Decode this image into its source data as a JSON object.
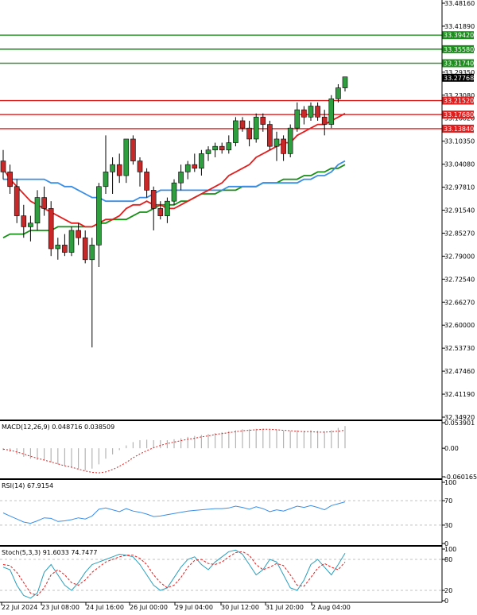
{
  "chart_data": {
    "type": "candlestick",
    "main": {
      "ylim": [
        32.3492,
        33.4816
      ],
      "y_ticks": [
        "33.48160",
        "33.41890",
        "33.35580",
        "33.29350",
        "33.23080",
        "33.16820",
        "33.10350",
        "33.04080",
        "32.97810",
        "32.91540",
        "32.85270",
        "32.79000",
        "32.72540",
        "32.66270",
        "32.60000",
        "32.53730",
        "32.47460",
        "32.41190",
        "32.34920"
      ],
      "current_price": {
        "label": "33.27768",
        "value": 33.27768
      },
      "levels": [
        {
          "label": "33.39420",
          "value": 33.3942,
          "color": "#1e8c1e"
        },
        {
          "label": "33.35580",
          "value": 33.3558,
          "color": "#1e8c1e"
        },
        {
          "label": "33.31740",
          "value": 33.3174,
          "color": "#1e8c1e"
        },
        {
          "label": "33.21520",
          "value": 33.2152,
          "color": "#dd1f1f"
        },
        {
          "label": "33.17680",
          "value": 33.1768,
          "color": "#dd1f1f"
        },
        {
          "label": "33.13840",
          "value": 33.1384,
          "color": "#dd1f1f"
        }
      ],
      "candles": [
        [
          33.05,
          33.08,
          33.0,
          33.02
        ],
        [
          33.02,
          33.04,
          32.96,
          32.98
        ],
        [
          32.98,
          33.0,
          32.88,
          32.9
        ],
        [
          32.9,
          32.93,
          32.84,
          32.87
        ],
        [
          32.87,
          32.9,
          32.83,
          32.88
        ],
        [
          32.88,
          32.97,
          32.86,
          32.95
        ],
        [
          32.95,
          32.98,
          32.9,
          32.92
        ],
        [
          32.92,
          32.94,
          32.79,
          32.81
        ],
        [
          32.81,
          32.84,
          32.78,
          32.82
        ],
        [
          32.82,
          32.85,
          32.79,
          32.8
        ],
        [
          32.8,
          32.87,
          32.79,
          32.86
        ],
        [
          32.86,
          32.88,
          32.82,
          32.84
        ],
        [
          32.84,
          32.86,
          32.77,
          32.78
        ],
        [
          32.78,
          32.84,
          32.54,
          32.82
        ],
        [
          32.82,
          32.99,
          32.76,
          32.98
        ],
        [
          32.98,
          33.12,
          32.96,
          33.02
        ],
        [
          33.02,
          33.06,
          32.96,
          33.04
        ],
        [
          33.04,
          33.07,
          32.99,
          33.01
        ],
        [
          33.01,
          33.11,
          32.99,
          33.11
        ],
        [
          33.11,
          33.12,
          33.04,
          33.05
        ],
        [
          33.05,
          33.06,
          32.98,
          33.02
        ],
        [
          33.02,
          33.03,
          32.95,
          32.97
        ],
        [
          32.97,
          32.98,
          32.86,
          32.92
        ],
        [
          32.92,
          32.94,
          32.89,
          32.9
        ],
        [
          32.9,
          32.95,
          32.88,
          32.94
        ],
        [
          32.94,
          33.0,
          32.93,
          32.99
        ],
        [
          32.99,
          33.04,
          32.97,
          33.02
        ],
        [
          33.02,
          33.05,
          33.0,
          33.04
        ],
        [
          33.04,
          33.07,
          33.02,
          33.03
        ],
        [
          33.03,
          33.08,
          33.01,
          33.07
        ],
        [
          33.07,
          33.09,
          33.05,
          33.08
        ],
        [
          33.08,
          33.1,
          33.06,
          33.09
        ],
        [
          33.09,
          33.1,
          33.07,
          33.08
        ],
        [
          33.08,
          33.12,
          33.07,
          33.1
        ],
        [
          33.1,
          33.17,
          33.09,
          33.16
        ],
        [
          33.16,
          33.17,
          33.13,
          33.14
        ],
        [
          33.14,
          33.16,
          33.09,
          33.11
        ],
        [
          33.11,
          33.18,
          33.1,
          33.17
        ],
        [
          33.17,
          33.18,
          33.13,
          33.15
        ],
        [
          33.15,
          33.16,
          33.08,
          33.09
        ],
        [
          33.09,
          33.13,
          33.05,
          33.11
        ],
        [
          33.11,
          33.12,
          33.05,
          33.07
        ],
        [
          33.07,
          33.15,
          33.06,
          33.14
        ],
        [
          33.14,
          33.21,
          33.13,
          33.19
        ],
        [
          33.19,
          33.2,
          33.15,
          33.17
        ],
        [
          33.17,
          33.21,
          33.16,
          33.2
        ],
        [
          33.2,
          33.21,
          33.16,
          33.17
        ],
        [
          33.17,
          33.19,
          33.12,
          33.15
        ],
        [
          33.15,
          33.23,
          33.14,
          33.22
        ],
        [
          33.22,
          33.26,
          33.21,
          33.25
        ],
        [
          33.25,
          33.28,
          33.24,
          33.28
        ]
      ],
      "ma_fast": [
        33.03,
        33.0,
        32.98,
        32.96,
        32.94,
        32.93,
        32.92,
        32.91,
        32.9,
        32.89,
        32.88,
        32.88,
        32.87,
        32.87,
        32.88,
        32.89,
        32.89,
        32.9,
        32.92,
        32.93,
        32.93,
        32.94,
        32.93,
        32.93,
        32.92,
        32.92,
        32.93,
        32.94,
        32.95,
        32.96,
        32.97,
        32.98,
        32.99,
        33.01,
        33.02,
        33.03,
        33.04,
        33.06,
        33.07,
        33.08,
        33.09,
        33.1,
        33.1,
        33.12,
        33.13,
        33.14,
        33.15,
        33.15,
        33.16,
        33.17,
        33.18
      ],
      "ma_mid": [
        33.0,
        33.0,
        33.0,
        33.0,
        33.0,
        33.0,
        33.0,
        32.99,
        32.99,
        32.98,
        32.98,
        32.97,
        32.96,
        32.95,
        32.95,
        32.94,
        32.94,
        32.94,
        32.94,
        32.94,
        32.95,
        32.95,
        32.96,
        32.97,
        32.97,
        32.97,
        32.97,
        32.97,
        32.97,
        32.97,
        32.97,
        32.97,
        32.97,
        32.98,
        32.98,
        32.98,
        32.98,
        32.98,
        32.99,
        32.99,
        32.99,
        32.99,
        32.99,
        32.99,
        33.0,
        33.0,
        33.01,
        33.01,
        33.02,
        33.04,
        33.05
      ],
      "ma_slow": [
        32.84,
        32.85,
        32.85,
        32.85,
        32.86,
        32.86,
        32.86,
        32.86,
        32.87,
        32.87,
        32.87,
        32.87,
        32.87,
        32.87,
        32.88,
        32.88,
        32.89,
        32.89,
        32.89,
        32.9,
        32.91,
        32.91,
        32.92,
        32.93,
        32.93,
        32.93,
        32.94,
        32.94,
        32.95,
        32.96,
        32.96,
        32.96,
        32.97,
        32.97,
        32.97,
        32.98,
        32.98,
        32.98,
        32.99,
        32.99,
        32.99,
        33.0,
        33.0,
        33.0,
        33.01,
        33.01,
        33.02,
        33.02,
        33.03,
        33.03,
        33.04
      ],
      "ma_colors": {
        "fast": "#e31e1e",
        "mid": "#3a8ee6",
        "slow": "#168f16"
      }
    },
    "macd": {
      "label": "MACD(12,26,9) 0.048716 0.038509",
      "ylim": [
        -0.060165,
        0.053901
      ],
      "y_ticks": [
        "0.053901",
        "0.00",
        "-0.060165"
      ],
      "histogram": [
        -0.004,
        -0.008,
        -0.013,
        -0.018,
        -0.022,
        -0.025,
        -0.026,
        -0.03,
        -0.034,
        -0.038,
        -0.04,
        -0.043,
        -0.047,
        -0.043,
        -0.034,
        -0.022,
        -0.013,
        -0.004,
        0.006,
        0.013,
        0.017,
        0.018,
        0.017,
        0.017,
        0.017,
        0.019,
        0.021,
        0.024,
        0.026,
        0.028,
        0.03,
        0.032,
        0.034,
        0.036,
        0.038,
        0.04,
        0.04,
        0.041,
        0.041,
        0.039,
        0.039,
        0.037,
        0.037,
        0.038,
        0.037,
        0.038,
        0.037,
        0.036,
        0.038,
        0.043,
        0.047
      ],
      "signal": [
        -0.002,
        -0.004,
        -0.008,
        -0.012,
        -0.017,
        -0.021,
        -0.025,
        -0.029,
        -0.033,
        -0.037,
        -0.04,
        -0.044,
        -0.048,
        -0.051,
        -0.052,
        -0.05,
        -0.045,
        -0.038,
        -0.03,
        -0.02,
        -0.012,
        -0.005,
        0.001,
        0.006,
        0.01,
        0.013,
        0.016,
        0.019,
        0.021,
        0.024,
        0.026,
        0.029,
        0.031,
        0.033,
        0.035,
        0.037,
        0.038,
        0.039,
        0.04,
        0.04,
        0.039,
        0.038,
        0.037,
        0.036,
        0.035,
        0.035,
        0.034,
        0.034,
        0.035,
        0.036,
        0.038
      ],
      "hist_color": "#b4b4b4",
      "signal_color": "#dd1f1f"
    },
    "rsi": {
      "label": "RSI(14) 67.9154",
      "ylim": [
        0,
        100
      ],
      "y_ticks": [
        "100",
        "70",
        "30",
        "0"
      ],
      "values": [
        50,
        45,
        40,
        35,
        33,
        37,
        42,
        41,
        36,
        37,
        39,
        42,
        40,
        45,
        56,
        58,
        55,
        52,
        57,
        53,
        51,
        48,
        44,
        45,
        47,
        49,
        51,
        53,
        54,
        55,
        56,
        57,
        57,
        58,
        61,
        59,
        56,
        60,
        57,
        52,
        55,
        53,
        57,
        61,
        59,
        62,
        59,
        55,
        62,
        65,
        68
      ],
      "color": "#3a8ee6"
    },
    "stoch": {
      "label": "Stoch(5,3,3) 91.6033 74.7477",
      "ylim": [
        0,
        100
      ],
      "y_ticks": [
        "100",
        "80",
        "20",
        "0"
      ],
      "k": [
        65,
        60,
        30,
        10,
        5,
        15,
        55,
        70,
        50,
        30,
        20,
        35,
        55,
        70,
        75,
        80,
        85,
        90,
        88,
        85,
        70,
        50,
        30,
        20,
        25,
        45,
        65,
        80,
        85,
        70,
        60,
        75,
        85,
        95,
        98,
        90,
        70,
        50,
        60,
        80,
        75,
        50,
        25,
        20,
        40,
        70,
        80,
        65,
        50,
        70,
        92
      ],
      "d": [
        70,
        68,
        55,
        35,
        15,
        10,
        25,
        50,
        60,
        50,
        35,
        30,
        40,
        55,
        65,
        75,
        80,
        85,
        88,
        88,
        82,
        70,
        50,
        35,
        25,
        30,
        45,
        65,
        78,
        80,
        72,
        70,
        75,
        85,
        93,
        95,
        88,
        70,
        60,
        65,
        72,
        68,
        50,
        30,
        28,
        45,
        63,
        72,
        65,
        60,
        75
      ],
      "k_color": "#2a9fbc",
      "d_color": "#e31e1e"
    },
    "x_tick_labels": [
      "22 Jul 2024",
      "23 Jul 08:00",
      "24 Jul 16:00",
      "26 Jul 00:00",
      "29 Jul 04:00",
      "30 Jul 12:00",
      "31 Jul 20:00",
      "2 Aug 04:00"
    ]
  }
}
